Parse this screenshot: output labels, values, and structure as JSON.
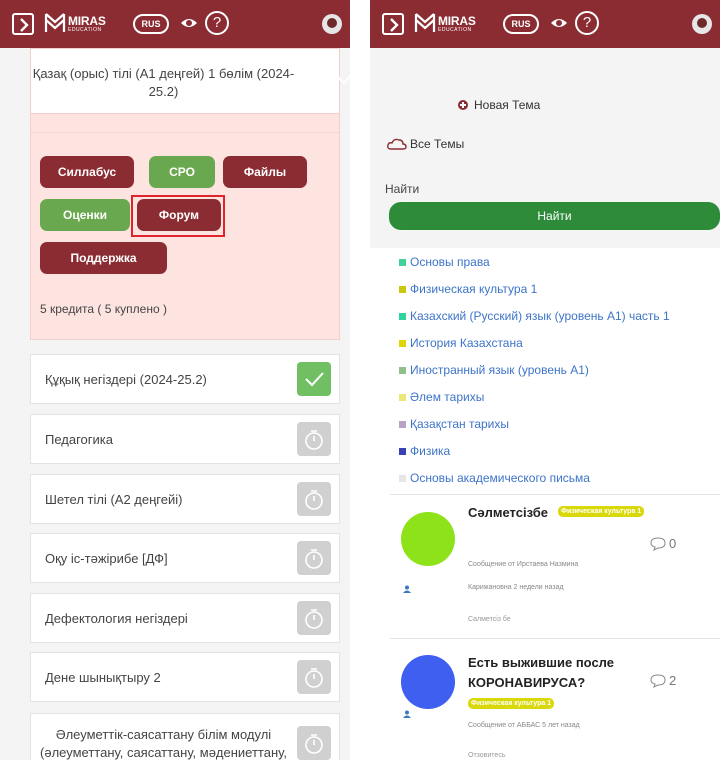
{
  "header": {
    "brand": "MIRAS",
    "brand_sub": "EDUCATION",
    "language": "RUS",
    "icons": [
      "menu-icon",
      "logo-icon",
      "eye-icon",
      "help-icon",
      "avatar-icon"
    ]
  },
  "colors": {
    "brand": "#8b2c33",
    "done": "#70c063",
    "pending": "#d0d0d0",
    "search": "#2e8b3a",
    "tag": "#d8d80a"
  },
  "left": {
    "expanded_course": {
      "title": "Қазақ (орыс) тілі (А1 деңгей) 1 бөлім (2024-25.2)",
      "status": "done",
      "buttons": {
        "syllabus": "Силлабус",
        "sro": "СРО",
        "files": "Файлы",
        "grades": "Оценки",
        "forum": "Форум",
        "support": "Поддержка"
      },
      "credits": "5 кредита ( 5 куплено )"
    },
    "courses": [
      {
        "title": "Құқық негіздері (2024-25.2)",
        "status": "done"
      },
      {
        "title": "Педагогика",
        "status": "pending"
      },
      {
        "title": "Шетел тілі (А2 деңгейі)",
        "status": "pending"
      },
      {
        "title": "Оқу іс-тәжірибе [ДФ]",
        "status": "pending"
      },
      {
        "title": "Дефектология негіздері",
        "status": "pending"
      },
      {
        "title": "Дене шынықтыру 2",
        "status": "pending"
      },
      {
        "title_line1": "Әлеуметтік-саясаттану білім модулі",
        "title_line2": "(әлеуметтану, саясаттану, мәдениеттану,",
        "status": "pending"
      }
    ]
  },
  "right": {
    "new_topic": "Новая Тема",
    "all_topics": "Все Темы",
    "search_label": "Найти",
    "search_button": "Найти",
    "categories": [
      {
        "name": "Основы права",
        "color": "#3fd39a"
      },
      {
        "name": "Физическая культура 1",
        "color": "#c9c80d"
      },
      {
        "name": "Казахский (Русский) язык (уровень А1) часть 1",
        "color": "#2fd39e"
      },
      {
        "name": "История Казахстана",
        "color": "#e0d50a"
      },
      {
        "name": "Иностранный язык (уровень А1)",
        "color": "#8fbf8a"
      },
      {
        "name": "Әлем тарихы",
        "color": "#eae877"
      },
      {
        "name": "Қазақстан тарихы",
        "color": "#b8a3c6"
      },
      {
        "name": "Физика",
        "color": "#3b40b4"
      },
      {
        "name": "Основы академического письма",
        "color": "#e6e6e6"
      }
    ],
    "posts": [
      {
        "title": "Сәлметсізбе",
        "tag": "Физическая культура 1",
        "meta_line1": "Сообщение от Ирстаева Назмина",
        "meta_line2": "Карижановна 2 недели назад",
        "snippet": "Салметсіз бе",
        "comments": "0",
        "avatar_color": "#8de21a"
      },
      {
        "title_line1": "Есть выжившие после",
        "title_line2": "КОРОНАВИРУСА?",
        "tag": "Физическая культура 1",
        "meta": "Сообщение от АББАС 5 лет назад",
        "snippet": "Отзовитесь",
        "comments": "2",
        "avatar_color": "#3e5ff0"
      }
    ]
  }
}
